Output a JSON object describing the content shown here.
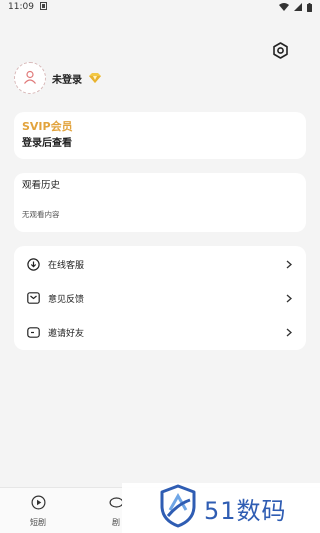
{
  "status_bar": {
    "time": "11:09"
  },
  "profile": {
    "login_status": "未登录"
  },
  "svip": {
    "title": "SVIP会员",
    "subtitle": "登录后查看"
  },
  "history": {
    "title": "观看历史",
    "empty_text": "无观看内容"
  },
  "menu": {
    "items": [
      {
        "icon": "download-icon",
        "label": "在线客服"
      },
      {
        "icon": "mail-icon",
        "label": "意见反馈"
      },
      {
        "icon": "ticket-icon",
        "label": "邀请好友"
      }
    ]
  },
  "tabs": [
    {
      "icon": "play-circle-icon",
      "label": "短剧"
    },
    {
      "icon": "drama-icon",
      "label": "剧"
    }
  ],
  "watermark": {
    "text": "51数码"
  },
  "colors": {
    "accent_gold": "#e2a33d",
    "watermark_blue": "#2f5db3",
    "background": "#f4f4f4"
  }
}
